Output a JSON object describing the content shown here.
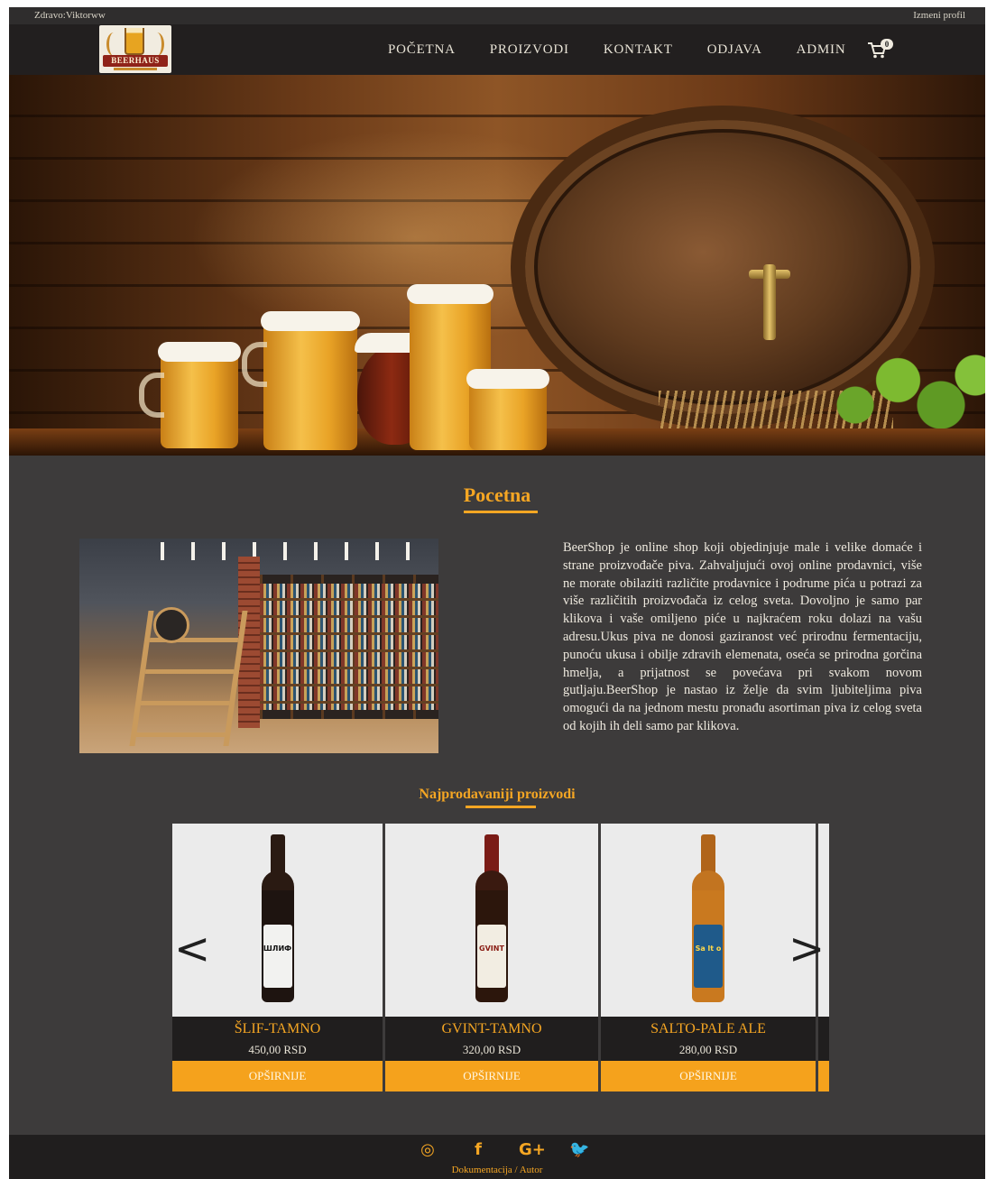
{
  "topbar": {
    "greeting": "Zdravo:Viktorww",
    "edit_profile": "Izmeni profil"
  },
  "logo": {
    "text": "BEERHAUS"
  },
  "nav": {
    "items": [
      {
        "label": "POČETNA"
      },
      {
        "label": "PROIZVODI"
      },
      {
        "label": "KONTAKT"
      },
      {
        "label": "ODJAVA"
      },
      {
        "label": "ADMIN"
      }
    ],
    "cart_count": "0",
    "cart_icon": "cart-icon"
  },
  "main": {
    "title": "Pocetna",
    "about_text": "BeerShop je online shop koji objedinjuje male i velike domaće i strane proizvođače piva. Zahvaljujući ovoj online prodavnici, više ne morate obilaziti različite prodavnice i podrume pića u potrazi za više različitih proizvođača iz celog sveta. Dovoljno je samo par klikova i vaše omiljeno piće u najkraćem roku dolazi na vašu adresu.Ukus piva ne donosi gaziranost već prirodnu fermentaciju, punoću ukusa i obilje zdravih elemenata, oseća se prirodna gorčina hmelja, a prijatnost se povećava pri svakom novom gutljaju.BeerShop je nastao iz želje da svim ljubiteljima piva omogući da na jednom mestu pronađu asortiman piva iz celog sveta od kojih ih deli samo par klikova."
  },
  "bestsellers": {
    "title": "Najprodavaniji proizvodi",
    "prev_arrow": "<",
    "next_arrow": ">",
    "products": [
      {
        "name": "ŠLIF-TAMNO",
        "price": "450,00 RSD",
        "button": "OPŠIRNIJE",
        "label_text": "ШЛИФ"
      },
      {
        "name": "GVINT-TAMNO",
        "price": "320,00 RSD",
        "button": "OPŠIRNIJE",
        "label_text": "GVINT"
      },
      {
        "name": "SALTO-PALE ALE",
        "price": "280,00 RSD",
        "button": "OPŠIRNIJE",
        "label_text": "Sa lt o"
      }
    ]
  },
  "footer": {
    "icons": [
      "instagram-icon",
      "facebook-icon",
      "google-plus-icon",
      "twitter-icon"
    ],
    "icon_glyphs": [
      "◎",
      "f",
      "G+",
      "🐦"
    ],
    "links": "Dokumentacija / Autor"
  },
  "colors": {
    "accent": "#f5a623",
    "background": "#3d3b3b",
    "nav": "#221f1f"
  }
}
